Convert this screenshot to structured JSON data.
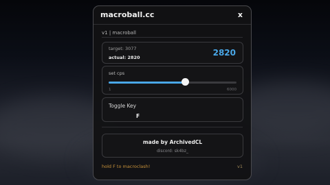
{
  "window": {
    "title": "macroball.cc",
    "close_label": "x"
  },
  "subtitle": "v1 | macroball",
  "stats": {
    "target_text": "target: 3077",
    "actual_text": "actual: 2820",
    "big_value": "2820"
  },
  "cps": {
    "label": "set cps",
    "min_label": "1",
    "max_label": "6000",
    "fill_fraction": 0.6
  },
  "toggle": {
    "label": "Toggle Key",
    "key": "F"
  },
  "credits": {
    "title": "made by ArchivedCL",
    "discord": "discord: sk4bz_"
  },
  "footer": {
    "hint": "hold F to macroclash!",
    "version": "v1"
  },
  "colors": {
    "accent": "#4aa8e8",
    "hint": "#c9923a"
  }
}
